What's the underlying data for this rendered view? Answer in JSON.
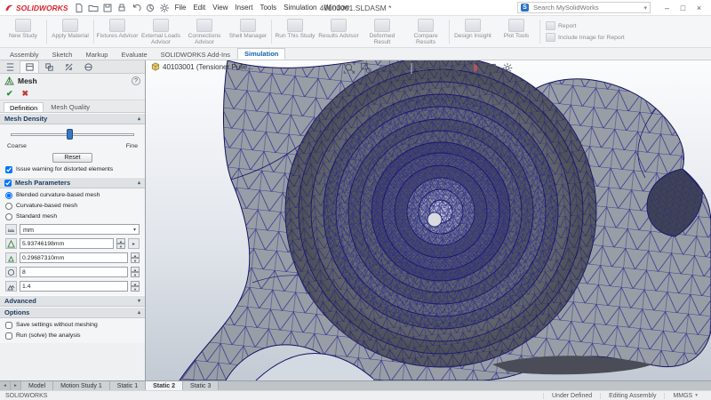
{
  "titlebar": {
    "brand": "SOLIDWORKS",
    "menus": [
      "File",
      "Edit",
      "View",
      "Insert",
      "Tools",
      "Simulation",
      "Window"
    ],
    "doc_title": "40103001.SLDASM *",
    "search_placeholder": "Search MySolidWorks"
  },
  "glyphs": {
    "spin_up": "▴",
    "spin_down": "▾",
    "dropdown": "▾",
    "section_open": "▴",
    "section_closed": "▾",
    "nav_left": "◂",
    "nav_right": "▸",
    "win_min": "–",
    "win_max": "□",
    "win_close": "×",
    "ok": "✔",
    "cancel": "✖",
    "help": "?"
  },
  "ribbon": {
    "items": [
      {
        "label": "New Study"
      },
      {
        "label": "Apply Material"
      },
      {
        "label": "Fixtures Advisor"
      },
      {
        "label": "External Loads Advisor"
      },
      {
        "label": "Connections Advisor"
      },
      {
        "label": "Shell Manager"
      },
      {
        "label": "Run This Study"
      },
      {
        "label": "Results Advisor"
      },
      {
        "label": "Deformed Result"
      },
      {
        "label": "Compare Results"
      },
      {
        "label": "Design Insight"
      },
      {
        "label": "Plot Tools"
      }
    ],
    "side_items": [
      {
        "label": "Report"
      },
      {
        "label": "Include Image for Report"
      }
    ]
  },
  "command_tabs": {
    "items": [
      "Assembly",
      "Sketch",
      "Markup",
      "Evaluate",
      "SOLIDWORKS Add-Ins",
      "Simulation"
    ],
    "active": "Simulation"
  },
  "panel": {
    "title": "Mesh",
    "tabs": [
      "Definition",
      "Mesh Quality"
    ],
    "active_tab": "Definition",
    "density": {
      "label": "Mesh Density",
      "coarse": "Coarse",
      "fine": "Fine",
      "reset": "Reset",
      "warning": "Issue warning for distorted elements",
      "warning_checked": true
    },
    "parameters": {
      "label": "Mesh Parameters",
      "options": [
        "Blended curvature-based mesh",
        "Curvature-based mesh",
        "Standard mesh"
      ],
      "selected_option": "Blended curvature-based mesh",
      "unit": "mm",
      "max_element_size": "5.93746198mm",
      "min_element_size": "0.29687310mm",
      "min_elements_in_circle": "8",
      "growth_ratio": "1.4"
    },
    "advanced_label": "Advanced",
    "options_section": {
      "label": "Options",
      "save": "Save settings without meshing",
      "run": "Run (solve) the analysis"
    }
  },
  "viewport": {
    "breadcrumb": "40103001 (Tensioner Pulle...",
    "hud_icons": [
      "zoom-fit",
      "zoom-area",
      "previous-view",
      "section-view",
      "view-orientation",
      "display-style",
      "hide-show-items",
      "edit-appearance",
      "apply-scene",
      "view-settings"
    ]
  },
  "bottom_tabs": {
    "items": [
      "Model",
      "Motion Study 1",
      "Static 1",
      "Static 2",
      "Static 3"
    ],
    "active": "Static 2"
  },
  "statusbar": {
    "app": "SOLIDWORKS",
    "state": "Under Defined",
    "mode": "Editing Assembly",
    "units": "MMGS"
  },
  "colors": {
    "accent": "#2a72c5",
    "mesh_line": "#2b2b8c",
    "logo_red": "#d9232e"
  }
}
